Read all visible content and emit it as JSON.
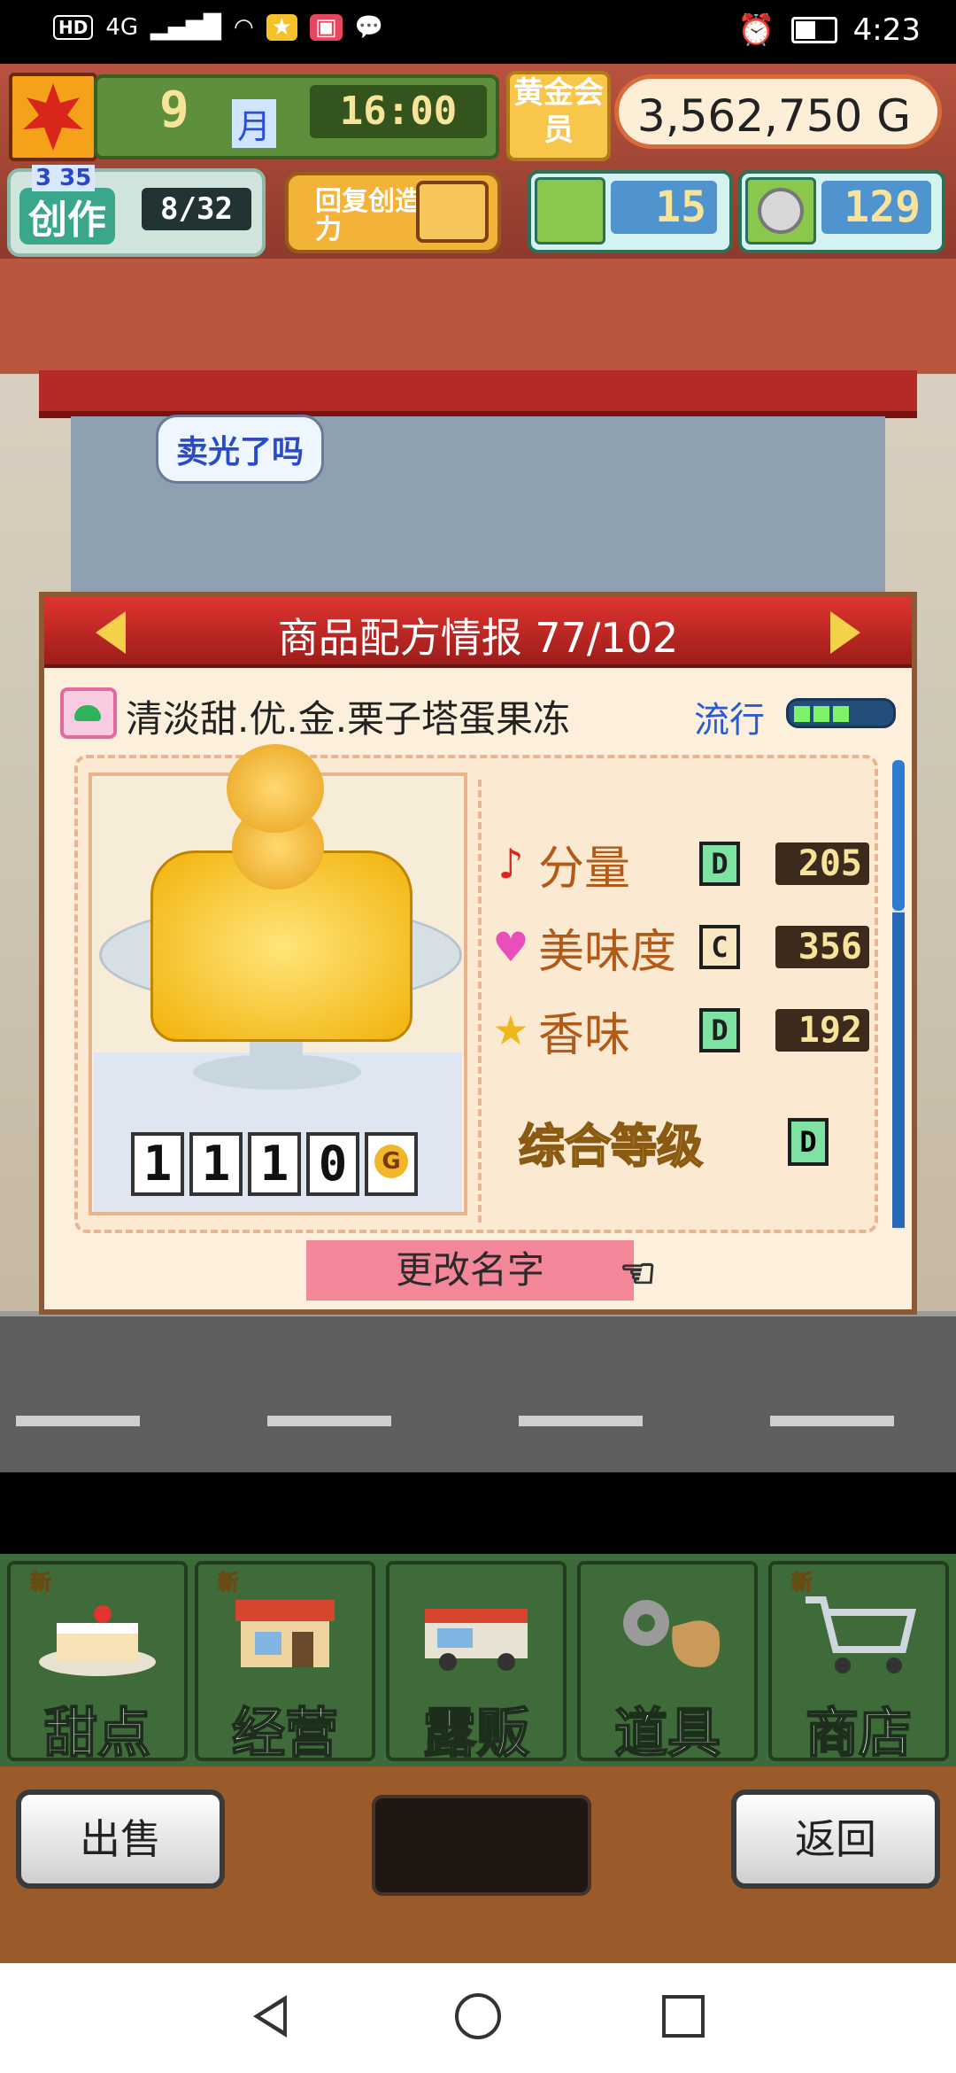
{
  "status_bar": {
    "network": "4G",
    "hd": "HD",
    "time": "4:23"
  },
  "hud": {
    "month": "9",
    "month_unit": "月",
    "clock": "16:00",
    "gold_member": "黄金会员",
    "money": "3,562,750 G",
    "create_level": "3 35",
    "create_label": "创作",
    "create_count": "8/32",
    "restore_label": "回复创造力",
    "tickets": "15",
    "coins": "129"
  },
  "scene": {
    "speech": "卖光了吗"
  },
  "dialog": {
    "title": "商品配方情报 77/102",
    "dessert_name": "清淡甜.优.金.栗子塔蛋果冻",
    "trend_label": "流行",
    "trend_level": 0.43,
    "price_digits": [
      "1",
      "1",
      "1",
      "0"
    ],
    "price_unit": "G",
    "stats": [
      {
        "icon": "music-note-icon",
        "name": "分量",
        "grade": "D",
        "value": "205"
      },
      {
        "icon": "heart-icon",
        "name": "美味度",
        "grade": "C",
        "value": "356"
      },
      {
        "icon": "star-icon",
        "name": "香味",
        "grade": "D",
        "value": "192"
      }
    ],
    "overall_label": "综合等级",
    "overall_grade": "D",
    "rename_label": "更改名字"
  },
  "menu": {
    "items": [
      {
        "label": "甜点",
        "new": "新"
      },
      {
        "label": "经营",
        "new": "新"
      },
      {
        "label": "露贩",
        "new": ""
      },
      {
        "label": "道具",
        "new": ""
      },
      {
        "label": "商店",
        "new": "新"
      }
    ]
  },
  "bottom": {
    "sell_label": "出售",
    "back_label": "返回"
  },
  "colors": {
    "header_red": "#c22a26",
    "accent_gold": "#f3d24a",
    "menu_green": "#3f6b3b"
  }
}
